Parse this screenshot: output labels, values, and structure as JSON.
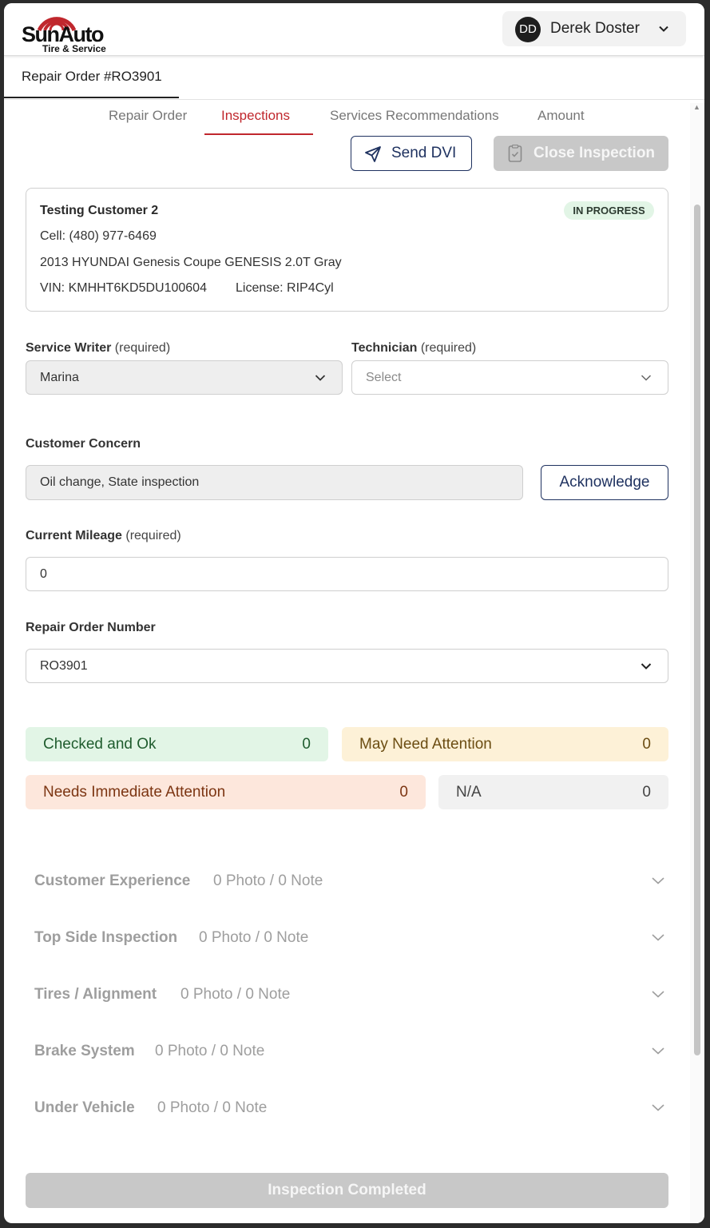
{
  "brand": {
    "name": "SunAuto",
    "tagline": "Tire & Service",
    "accent": "#c0272d",
    "navy": "#1f3260"
  },
  "user": {
    "initials": "DD",
    "name": "Derek Doster"
  },
  "page_tab": "Repair Order #RO3901",
  "tabs": [
    {
      "label": "Repair Order"
    },
    {
      "label": "Inspections"
    },
    {
      "label": "Services Recommendations"
    },
    {
      "label": "Amount"
    }
  ],
  "active_tab": "Inspections",
  "actions": {
    "send_dvi": "Send DVI",
    "close_inspection": "Close Inspection"
  },
  "customer": {
    "name": "Testing Customer 2",
    "status": "IN PROGRESS",
    "cell": "Cell: (480) 977-6469",
    "vehicle": "2013 HYUNDAI Genesis Coupe GENESIS 2.0T Gray",
    "vin": "VIN: KMHHT6KD5DU100604",
    "license": "License: RIP4Cyl"
  },
  "service_writer": {
    "label": "Service Writer",
    "required": "(required)",
    "value": "Marina"
  },
  "technician": {
    "label": "Technician",
    "required": "(required)",
    "placeholder": "Select"
  },
  "concern": {
    "label": "Customer Concern",
    "value": "Oil change,  State inspection",
    "ack_button": "Acknowledge"
  },
  "mileage": {
    "label": "Current Mileage",
    "required": "(required)",
    "value": "0"
  },
  "repair_order_number": {
    "label": "Repair Order Number",
    "value": "RO3901"
  },
  "stats": {
    "checked": {
      "label": "Checked and Ok",
      "count": "0",
      "bg": "#e2f5e6",
      "color": "#1f5c2e"
    },
    "may_need": {
      "label": "May Need Attention",
      "count": "0",
      "bg": "#fdf1d7",
      "color": "#6b4d12"
    },
    "immediate": {
      "label": "Needs Immediate Attention",
      "count": "0",
      "bg": "#fde7dc",
      "color": "#7c3512"
    },
    "na": {
      "label": "N/A",
      "count": "0",
      "bg": "#f1f1f1",
      "color": "#444444"
    }
  },
  "sections": [
    {
      "name": "Customer Experience",
      "counts": "0 Photo / 0 Note"
    },
    {
      "name": "Top Side Inspection",
      "counts": "0 Photo / 0 Note"
    },
    {
      "name": "Tires / Alignment",
      "counts": "0 Photo / 0 Note"
    },
    {
      "name": "Brake System",
      "counts": "0 Photo / 0 Note"
    },
    {
      "name": "Under Vehicle",
      "counts": "0 Photo / 0 Note"
    }
  ],
  "complete_button": "Inspection Completed"
}
